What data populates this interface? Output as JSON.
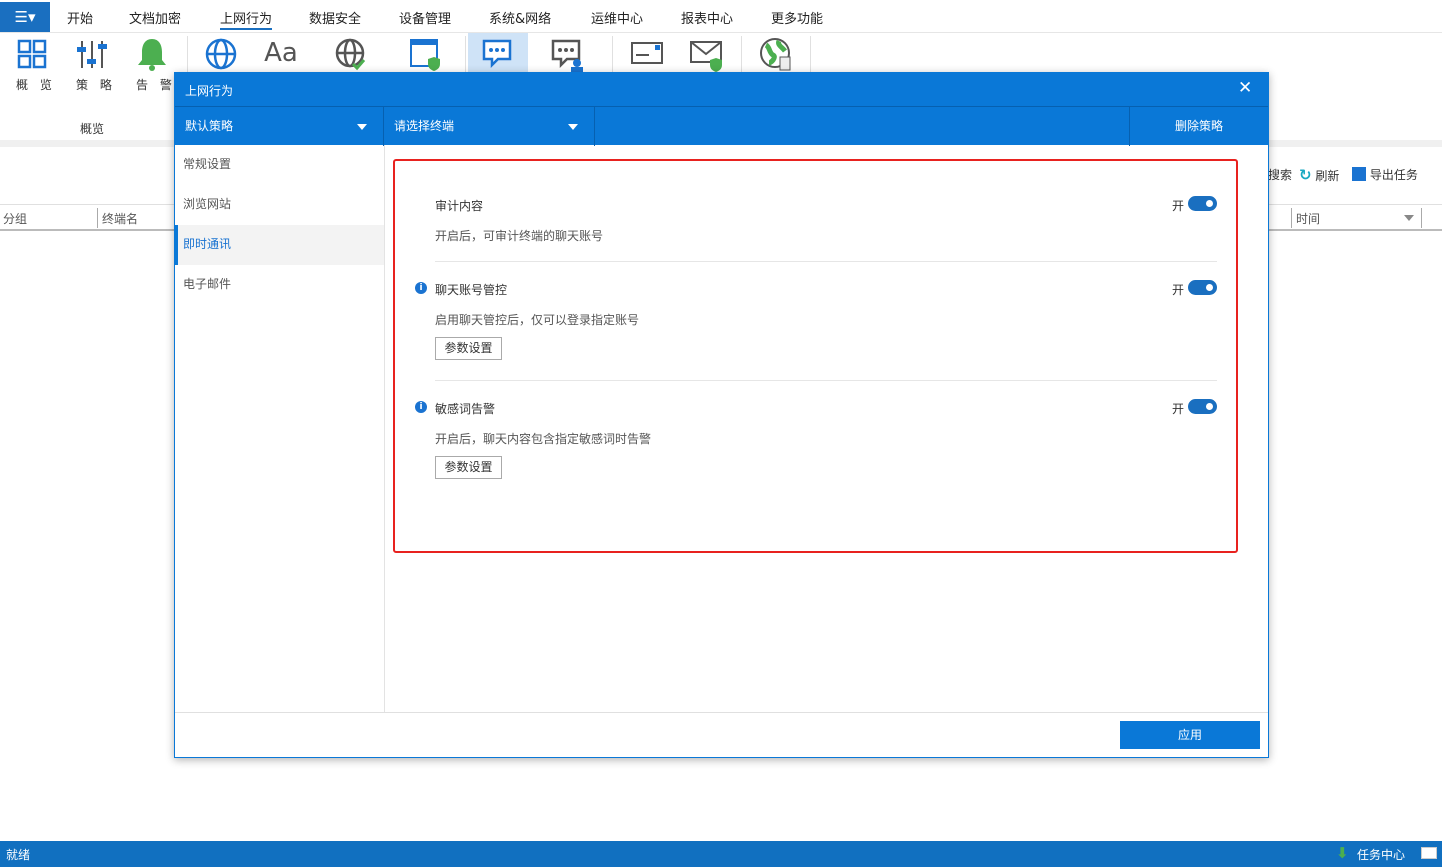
{
  "app_menu_icon": "app-menu-icon",
  "menu_tabs": [
    "开始",
    "文档加密",
    "上网行为",
    "数据安全",
    "设备管理",
    "系统&网络",
    "运维中心",
    "报表中心",
    "更多功能"
  ],
  "active_tab": "上网行为",
  "ribbon": {
    "items": [
      {
        "label": "概 览",
        "icon": "overview-grid-icon"
      },
      {
        "label": "策 略",
        "icon": "policy-sliders-icon"
      },
      {
        "label": "告 警",
        "icon": "alarm-bell-icon"
      }
    ],
    "group_label": "概览",
    "extra_icons": [
      "globe-icon",
      "font-icon",
      "globe-check-icon",
      "webpage-shield-icon",
      "chat-icon",
      "chat-user-icon",
      "mail-icon",
      "mail-shield-icon",
      "earth-file-icon"
    ]
  },
  "toolbar": {
    "search": "搜索",
    "refresh": "刷新",
    "export": "导出任务"
  },
  "table": {
    "columns": [
      "分组",
      "终端名",
      "时间"
    ]
  },
  "status": {
    "left": "就绪",
    "task_center": "任务中心"
  },
  "dialog": {
    "title": "上网行为",
    "policy_select": "默认策略",
    "terminal_select": "请选择终端",
    "delete_policy": "删除策略",
    "nav": [
      "常规设置",
      "浏览网站",
      "即时通讯",
      "电子邮件"
    ],
    "active_nav": "即时通讯",
    "sections": [
      {
        "title": "审计内容",
        "desc": "开启后，可审计终端的聊天账号",
        "toggle_label": "开",
        "on": true
      },
      {
        "title": "聊天账号管控",
        "desc": "启用聊天管控后，仅可以登录指定账号",
        "toggle_label": "开",
        "on": true,
        "button": "参数设置"
      },
      {
        "title": "敏感词告警",
        "desc": "开启后，聊天内容包含指定敏感词时告警",
        "toggle_label": "开",
        "on": true,
        "button": "参数设置"
      }
    ],
    "apply": "应用"
  },
  "colors": {
    "accent": "#0a78d7",
    "highlight_box": "#e8221f",
    "status_bar": "#1170c0"
  }
}
